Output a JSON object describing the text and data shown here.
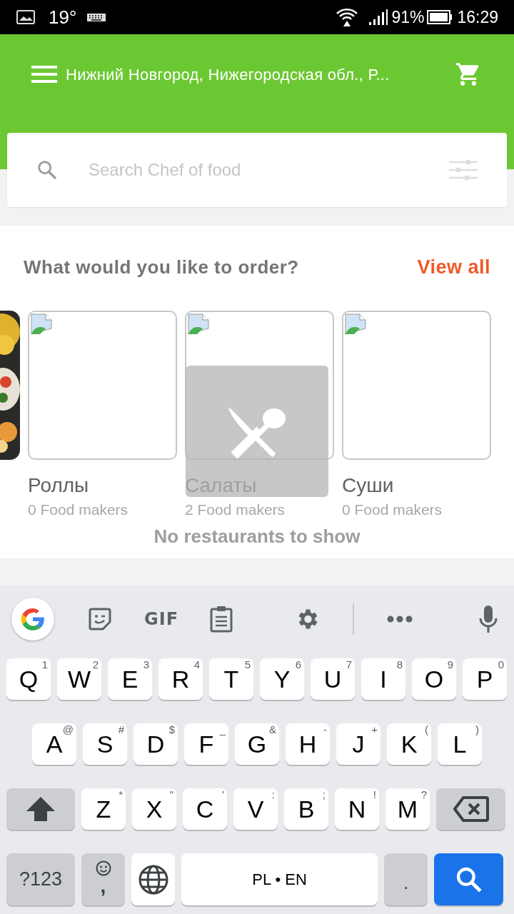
{
  "status_bar": {
    "temperature": "19°",
    "battery": "91%",
    "time": "16:29"
  },
  "header": {
    "location": "Нижний Новгород, Нижегородская обл., Р..."
  },
  "search": {
    "placeholder": "Search Chef of food"
  },
  "categories_section": {
    "title": "What would you like to order?",
    "view_all": "View all",
    "items": [
      {
        "kind": "picture"
      },
      {
        "kind": "category",
        "name": "Роллы",
        "count": "0 Food makers"
      },
      {
        "kind": "category",
        "name": "Салаты",
        "count": "2 Food makers"
      },
      {
        "kind": "category",
        "name": "Суши",
        "count": "0 Food makers"
      }
    ]
  },
  "empty_state": {
    "message": "No restaurants to show"
  },
  "keyboard": {
    "toolbar": {
      "gif": "GIF"
    },
    "rows": [
      [
        {
          "kind": "letter",
          "label": "Q",
          "hint": "1"
        },
        {
          "kind": "letter",
          "label": "W",
          "hint": "2"
        },
        {
          "kind": "letter",
          "label": "E",
          "hint": "3"
        },
        {
          "kind": "letter",
          "label": "R",
          "hint": "4"
        },
        {
          "kind": "letter",
          "label": "T",
          "hint": "5"
        },
        {
          "kind": "letter",
          "label": "Y",
          "hint": "6"
        },
        {
          "kind": "letter",
          "label": "U",
          "hint": "7"
        },
        {
          "kind": "letter",
          "label": "I",
          "hint": "8"
        },
        {
          "kind": "letter",
          "label": "O",
          "hint": "9"
        },
        {
          "kind": "letter",
          "label": "P",
          "hint": "0"
        }
      ],
      [
        {
          "kind": "letter",
          "label": "A",
          "hint": "@"
        },
        {
          "kind": "letter",
          "label": "S",
          "hint": "#"
        },
        {
          "kind": "letter",
          "label": "D",
          "hint": "$"
        },
        {
          "kind": "letter",
          "label": "F",
          "hint": "_"
        },
        {
          "kind": "letter",
          "label": "G",
          "hint": "&"
        },
        {
          "kind": "letter",
          "label": "H",
          "hint": "-"
        },
        {
          "kind": "letter",
          "label": "J",
          "hint": "+"
        },
        {
          "kind": "letter",
          "label": "K",
          "hint": "("
        },
        {
          "kind": "letter",
          "label": "L",
          "hint": ")"
        }
      ],
      [
        {
          "kind": "shift"
        },
        {
          "kind": "letter",
          "label": "Z",
          "hint": "*"
        },
        {
          "kind": "letter",
          "label": "X",
          "hint": "\""
        },
        {
          "kind": "letter",
          "label": "C",
          "hint": "'"
        },
        {
          "kind": "letter",
          "label": "V",
          "hint": ":"
        },
        {
          "kind": "letter",
          "label": "B",
          "hint": ";"
        },
        {
          "kind": "letter",
          "label": "N",
          "hint": "!"
        },
        {
          "kind": "letter",
          "label": "M",
          "hint": "?"
        },
        {
          "kind": "backspace"
        }
      ]
    ],
    "bottom_row": [
      {
        "kind": "symbols",
        "label": "?123"
      },
      {
        "kind": "emoji",
        "label": ","
      },
      {
        "kind": "globe"
      },
      {
        "kind": "space",
        "label": "PL • EN"
      },
      {
        "kind": "period",
        "label": "."
      },
      {
        "kind": "search"
      }
    ]
  }
}
